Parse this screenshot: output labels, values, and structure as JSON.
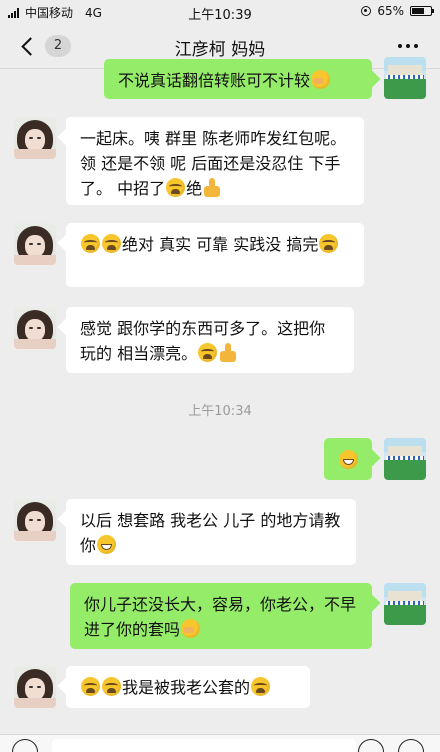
{
  "status_bar": {
    "carrier": "中国移动",
    "network": "4G",
    "time": "上午10:39",
    "battery_percent": "65%",
    "battery_level": 0.65
  },
  "nav": {
    "back_count": "2",
    "title": "江彦柯 妈妈",
    "more_icon": "more-dots-icon"
  },
  "messages": {
    "m0": {
      "text": "不说真话翻倍转账可不计较",
      "emoji": [
        "cover"
      ]
    },
    "m1": {
      "text": "一起床。咦 群里 陈老师咋发红包呢。领 还是不领 呢 后面还是没忍住 下手了。 中招了",
      "tail": "绝",
      "emoji": [
        "cry"
      ],
      "icon": "thumbs-up-icon"
    },
    "m2": {
      "text": "绝对 真实 可靠  实践没 搞完",
      "emoji": [
        "cry",
        "cry",
        "cry"
      ]
    },
    "m3": {
      "text": "感觉 跟你学的东西可多了。这把你玩的 相当漂亮。",
      "emoji": [
        "cry"
      ],
      "icon": "thumbs-up-icon"
    },
    "time_divider": "上午10:34",
    "m4": {
      "emoji": [
        "grin"
      ]
    },
    "m5": {
      "text": "以后 想套路 我老公 儿子 的地方请教你",
      "emoji": [
        "grin"
      ]
    },
    "m6": {
      "text": "你儿子还没长大，容易，你老公，不早进了你的套吗",
      "emoji": [
        "cover"
      ]
    },
    "m7": {
      "text": "我是被我老公套的",
      "emoji": [
        "cry",
        "cry",
        "cry"
      ]
    }
  },
  "colors": {
    "background": "#ededed",
    "sent_bubble": "#95ec69",
    "received_bubble": "#ffffff"
  },
  "input": {
    "placeholder": ""
  }
}
